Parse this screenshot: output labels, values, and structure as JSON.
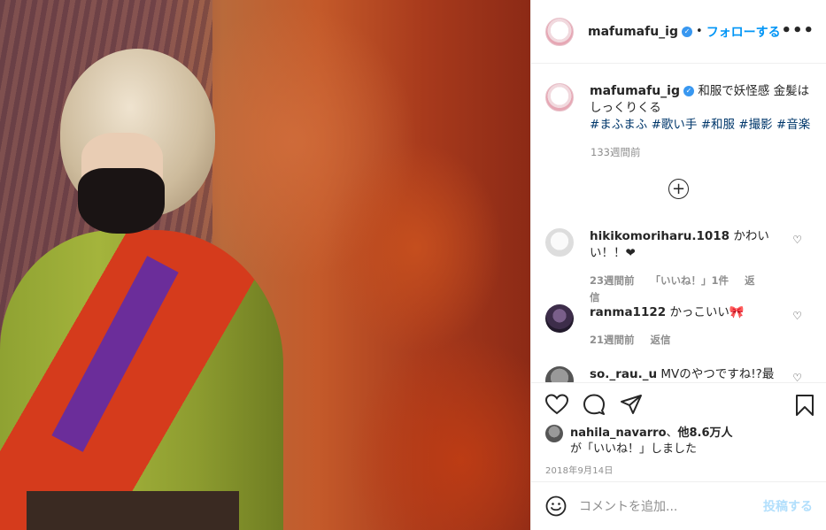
{
  "post": {
    "username": "mafumafu_ig",
    "follow_label": "フォローする",
    "separator": "•",
    "more_label": "•••",
    "caption": {
      "line1": "和服で妖怪感 金髪は",
      "line2": "しっくりくる",
      "hashtags": "#まふまふ #歌い手 #和服 #撮影 #音楽",
      "time": "133週間前"
    },
    "load_more_symbol": "+",
    "comments": [
      {
        "username": "hikikomoriharu.1018",
        "text": "かわいい！！❤",
        "time": "23週間前",
        "likes": "「いいね！」1件",
        "reply": "返信"
      },
      {
        "username": "ranma1122",
        "text": "かっこいい🎀",
        "time": "21週間前",
        "reply": "返信"
      },
      {
        "username": "so._rau._u",
        "text": "MVのやつですね!?最"
      }
    ],
    "likes": {
      "user": "nahila_navarro",
      "connector": "、",
      "others": "他8.6万人",
      "suffix": "が「いいね！」しました"
    },
    "date": "2018年9月14日",
    "add_comment_placeholder": "コメントを追加...",
    "post_label": "投稿する"
  },
  "colors": {
    "accent": "#0095f6",
    "verified": "#3897f0",
    "muted": "#8e8e8e",
    "post_disabled": "#b2dffc"
  },
  "icons": [
    "verified-badge-icon",
    "more-options-icon",
    "load-more-icon",
    "heart-icon",
    "comment-icon",
    "share-icon",
    "bookmark-icon",
    "emoji-icon"
  ]
}
